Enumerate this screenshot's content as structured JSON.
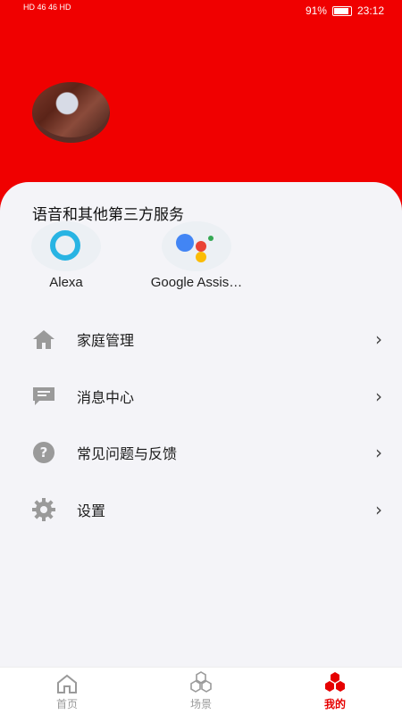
{
  "status": {
    "left": "HD 46 46 HD",
    "battery": "91%",
    "time": "23:12"
  },
  "section_title": "语音和其他第三方服务",
  "services": [
    {
      "label": "Alexa",
      "icon": "alexa-icon"
    },
    {
      "label": "Google Assis…",
      "icon": "google-assistant-icon"
    }
  ],
  "menu": [
    {
      "label": "家庭管理",
      "icon": "home-icon"
    },
    {
      "label": "消息中心",
      "icon": "message-icon"
    },
    {
      "label": "常见问题与反馈",
      "icon": "help-icon"
    },
    {
      "label": "设置",
      "icon": "gear-icon"
    }
  ],
  "tabs": [
    {
      "label": "首页",
      "icon": "home-outline-icon",
      "active": false
    },
    {
      "label": "场景",
      "icon": "hexagons-icon",
      "active": false
    },
    {
      "label": "我的",
      "icon": "hexagons-filled-icon",
      "active": true
    }
  ],
  "colors": {
    "header": "#f00000",
    "accent": "#e60000",
    "icon_gray": "#9a9a9a"
  }
}
